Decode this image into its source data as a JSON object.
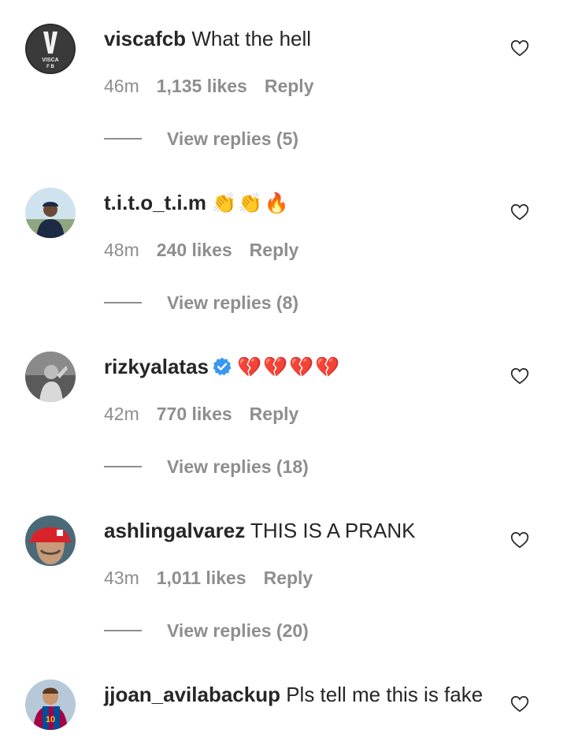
{
  "comments": [
    {
      "username": "viscafcb",
      "text": "What the hell",
      "verified": false,
      "emoji": "",
      "time": "46m",
      "likes": "1,135 likes",
      "reply": "Reply",
      "view_replies": "View replies (5)",
      "avatar_text": [
        "VISCA",
        "F B"
      ]
    },
    {
      "username": "t.i.t.o_t.i.m",
      "text": "",
      "verified": false,
      "emoji": "👏👏🔥",
      "time": "48m",
      "likes": "240 likes",
      "reply": "Reply",
      "view_replies": "View replies (8)"
    },
    {
      "username": "rizkyalatas",
      "text": "",
      "verified": true,
      "emoji": "💔💔💔💔",
      "time": "42m",
      "likes": "770 likes",
      "reply": "Reply",
      "view_replies": "View replies (18)"
    },
    {
      "username": "ashlingalvarez",
      "text": "THIS IS A PRANK",
      "verified": false,
      "emoji": "",
      "time": "43m",
      "likes": "1,011 likes",
      "reply": "Reply",
      "view_replies": "View replies (20)"
    },
    {
      "username": "jjoan_avilabackup",
      "text": "Pls tell me this is fake",
      "verified": false,
      "emoji": "",
      "avatar_text": [
        "10"
      ]
    }
  ],
  "colors": {
    "text": "#262626",
    "secondary": "#8e8e8e",
    "verified": "#3897f0"
  }
}
